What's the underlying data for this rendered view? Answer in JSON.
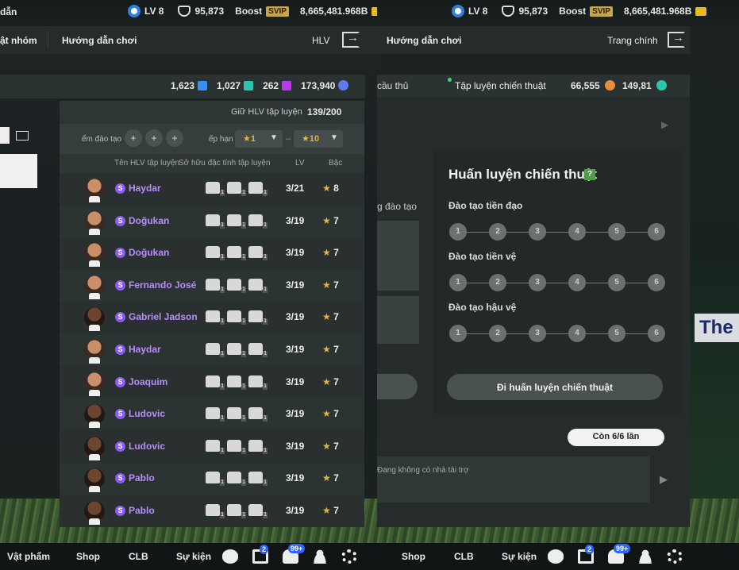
{
  "status": {
    "level": "LV 8",
    "shield": "95,873",
    "boost": "Boost",
    "svip": "SVIP",
    "gold": "8,665,481.968B"
  },
  "left": {
    "nav": {
      "item1": "ật nhóm",
      "item2": "Hướng dẫn chơi",
      "coach": "HLV"
    },
    "top_title": "dẫn",
    "currencies": {
      "a": "1,623",
      "b": "1,027",
      "c": "262",
      "total": "173,940"
    },
    "coach_capacity": {
      "label": "Giữ HLV tập luyện",
      "value": "139/200"
    },
    "filters": {
      "training_label": "ểm đào tạo",
      "rank_label": "ếp hạn",
      "rank_from": "★1",
      "rank_to": "★10",
      "dash": "–",
      "add_symbol": "+"
    },
    "columns": {
      "name": "Tên HLV tập luyện",
      "traits": "Sở hữu đặc tính tập luyện",
      "lv": "LV",
      "rank": "Bậc"
    },
    "rows": [
      {
        "name": "Haydar",
        "lv": "3/21",
        "rank": "8"
      },
      {
        "name": "Doğukan",
        "lv": "3/19",
        "rank": "7"
      },
      {
        "name": "Doğukan",
        "lv": "3/19",
        "rank": "7"
      },
      {
        "name": "Fernando José",
        "lv": "3/19",
        "rank": "7"
      },
      {
        "name": "Gabriel Jadson",
        "lv": "3/19",
        "rank": "7"
      },
      {
        "name": "Haydar",
        "lv": "3/19",
        "rank": "7"
      },
      {
        "name": "Joaquim",
        "lv": "3/19",
        "rank": "7"
      },
      {
        "name": "Ludovic",
        "lv": "3/19",
        "rank": "7"
      },
      {
        "name": "Ludovic",
        "lv": "3/19",
        "rank": "7"
      },
      {
        "name": "Pablo",
        "lv": "3/19",
        "rank": "7"
      },
      {
        "name": "Pablo",
        "lv": "3/19",
        "rank": "7"
      }
    ],
    "bottom": {
      "items": "Vật phẩm",
      "shop": "Shop",
      "clb": "CLB",
      "events": "Sự kiện",
      "badge_box": "2",
      "badge_bell": "99+"
    }
  },
  "right": {
    "nav": {
      "guide": "Hướng dẫn chơi",
      "home": "Trang chính"
    },
    "tabs": {
      "players": "cầu thủ",
      "tactical": "Tập luyện chiến thuật",
      "coin1": "66,555",
      "coin2": "149,81"
    },
    "side_label": "g đào tạo",
    "card": {
      "title": "Huấn luyện chiến thuật",
      "help": "?",
      "sections": [
        {
          "label": "Đào tạo tiền đạo",
          "steps": [
            "1",
            "2",
            "3",
            "4",
            "5",
            "6"
          ]
        },
        {
          "label": "Đào tạo tiền vệ",
          "steps": [
            "1",
            "2",
            "3",
            "4",
            "5",
            "6"
          ]
        },
        {
          "label": "Đào tạo hậu vệ",
          "steps": [
            "1",
            "2",
            "3",
            "4",
            "5",
            "6"
          ]
        }
      ],
      "button": "Đi huấn luyện chiến thuật"
    },
    "remaining": "Còn 6/6 lần",
    "sponsor": "Đang không có nhà tài trợ",
    "banner_text": "The",
    "bottom": {
      "shop": "Shop",
      "clb": "CLB",
      "events": "Sự kiện",
      "badge_box": "2",
      "badge_bell": "99+"
    }
  }
}
